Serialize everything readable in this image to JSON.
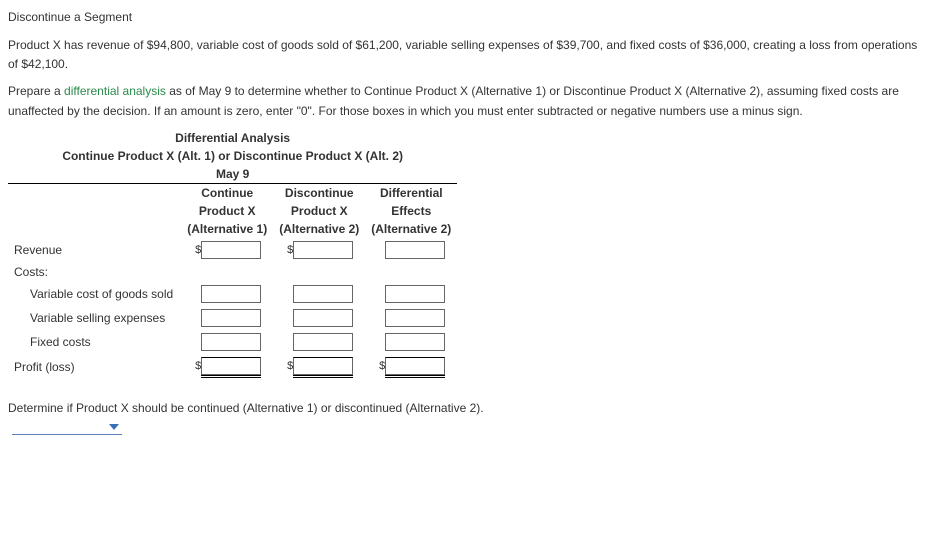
{
  "heading": "Discontinue a Segment",
  "para1": "Product X has revenue of $94,800, variable cost of goods sold of $61,200, variable selling expenses of $39,700, and fixed costs of $36,000, creating a loss from operations of $42,100.",
  "para2_a": "Prepare a ",
  "para2_link": "differential analysis",
  "para2_b": " as of May 9 to determine whether to Continue Product X (Alternative 1) or Discontinue Product X (Alternative 2), assuming fixed costs are unaffected by the decision. If an amount is zero, enter \"0\". For those boxes in which you must enter subtracted or negative numbers use a minus sign.",
  "table": {
    "title1": "Differential Analysis",
    "title2": "Continue Product X (Alt. 1) or Discontinue Product X (Alt. 2)",
    "title3": "May 9",
    "col1_l1": "Continue",
    "col1_l2": "Product X",
    "col1_l3": "(Alternative 1)",
    "col2_l1": "Discontinue",
    "col2_l2": "Product X",
    "col2_l3": "(Alternative 2)",
    "col3_l1": "Differential",
    "col3_l2": "Effects",
    "col3_l3": "(Alternative 2)",
    "row_revenue": "Revenue",
    "row_costs": "Costs:",
    "row_vcogs": "Variable cost of goods sold",
    "row_vse": "Variable selling expenses",
    "row_fixed": "Fixed costs",
    "row_profit": "Profit (loss)",
    "dollar": "$"
  },
  "footer": "Determine if Product X should be continued (Alternative 1) or discontinued (Alternative 2).",
  "inputs": {
    "rev_a1": "",
    "rev_a2": "",
    "rev_d": "",
    "vc1_a1": "",
    "vc1_a2": "",
    "vc1_d": "",
    "vc2_a1": "",
    "vc2_a2": "",
    "vc2_d": "",
    "fx_a1": "",
    "fx_a2": "",
    "fx_d": "",
    "pl_a1": "",
    "pl_a2": "",
    "pl_d": ""
  }
}
